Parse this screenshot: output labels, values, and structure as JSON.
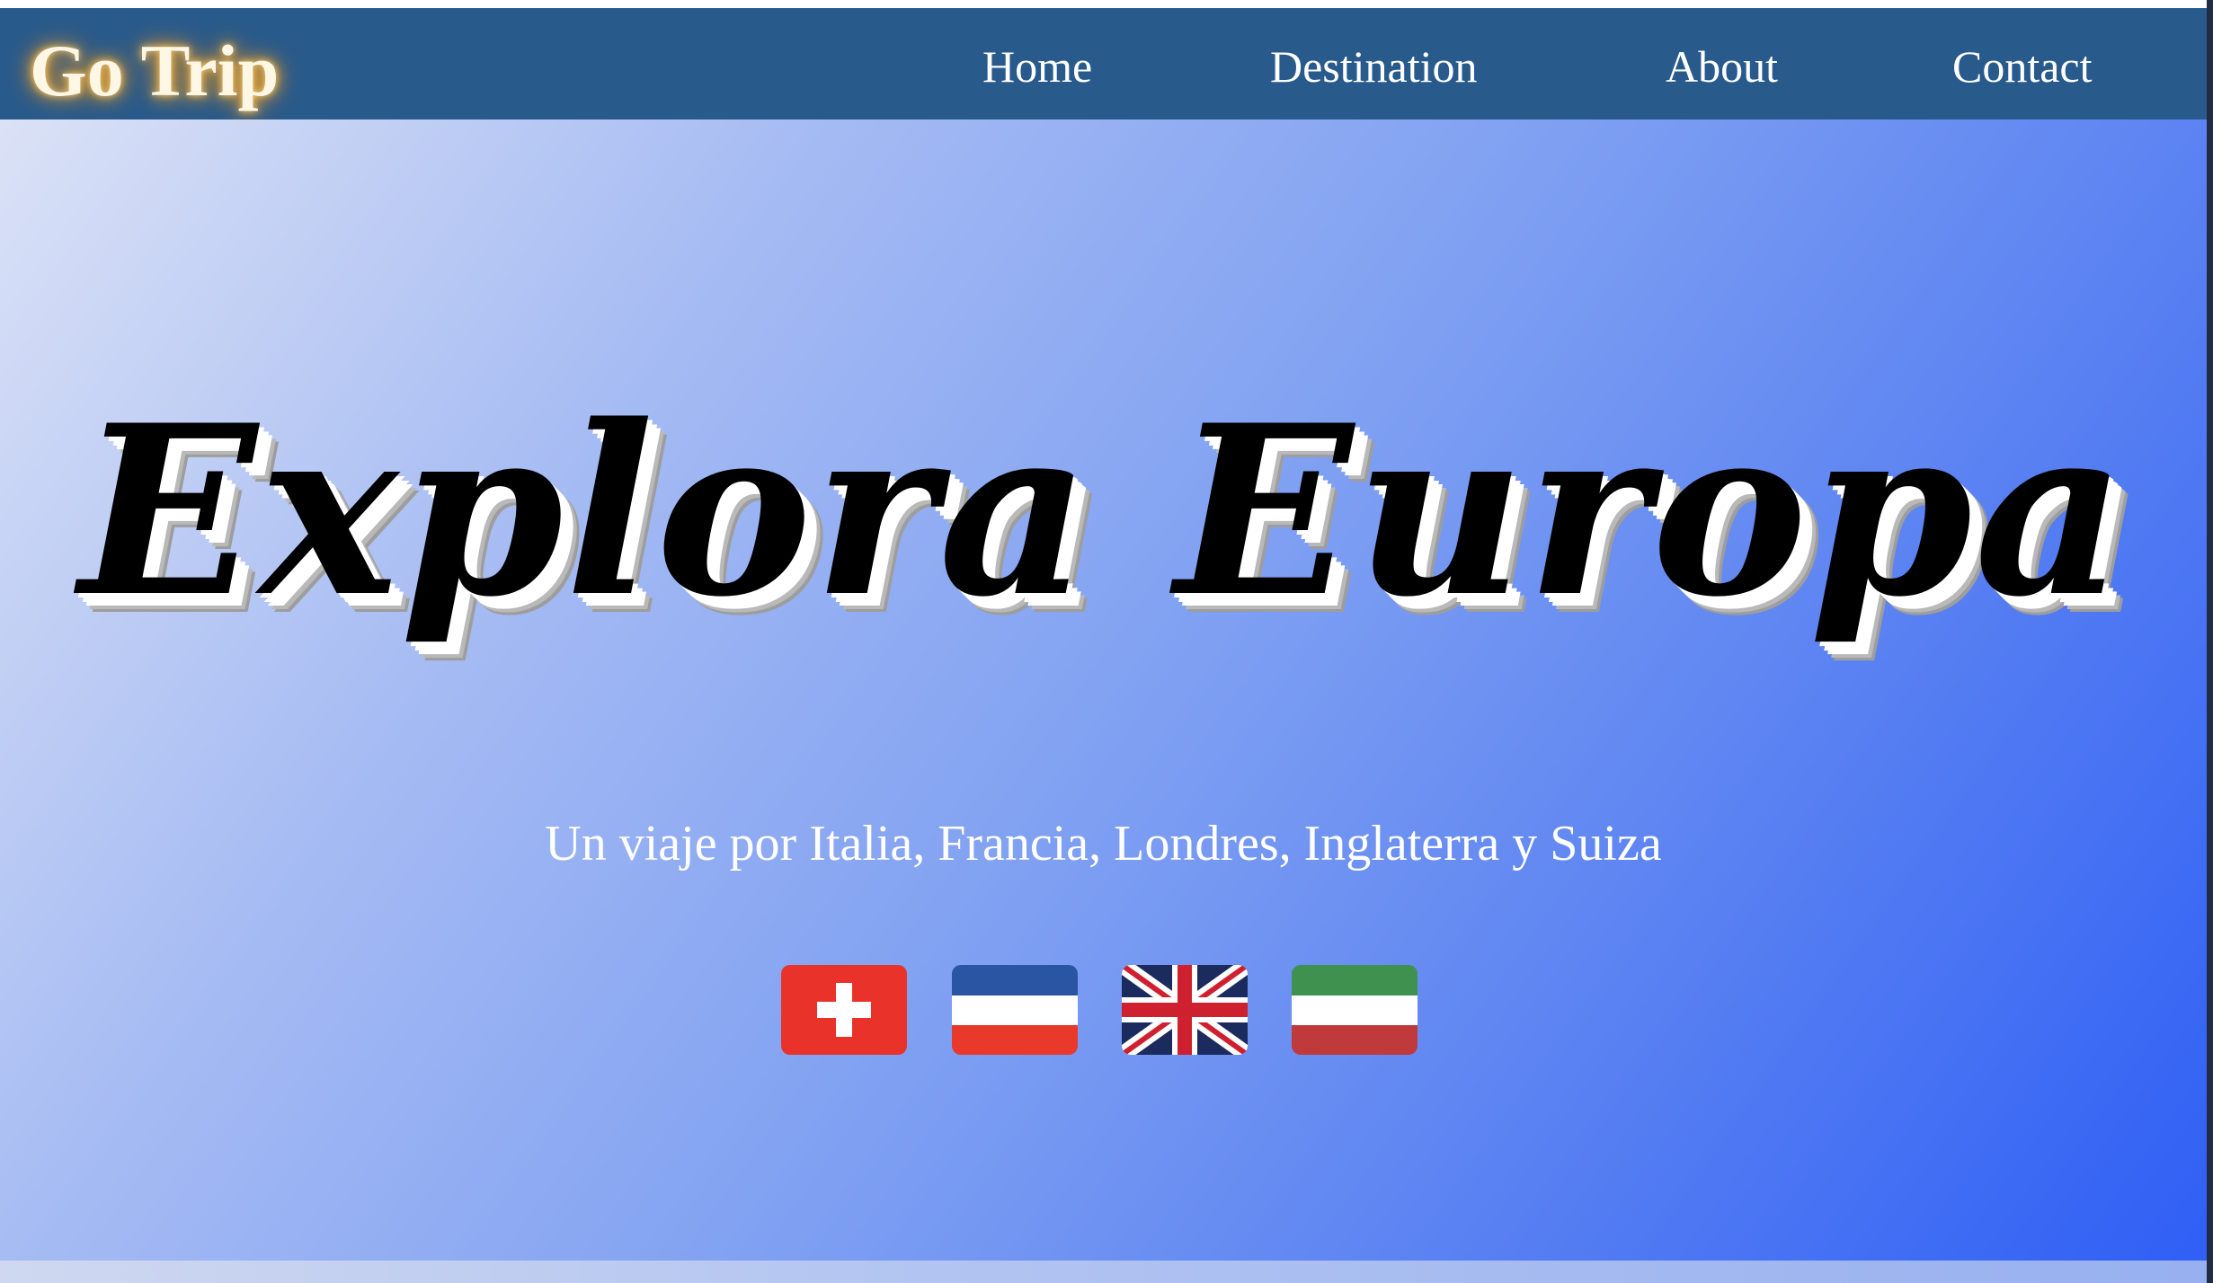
{
  "navbar": {
    "brand": "Go Trip",
    "links": [
      {
        "label": "Home"
      },
      {
        "label": "Destination"
      },
      {
        "label": "About"
      },
      {
        "label": "Contact"
      }
    ],
    "background": "#285a8c"
  },
  "hero": {
    "title": "Explora Europa",
    "subtitle": "Un viaje por Italia, Francia, Londres, Inglaterra y Suiza",
    "gradient": [
      "#dbe2f6",
      "#a4baf3",
      "#7fa0f2",
      "#5981f2",
      "#2f5ff5"
    ],
    "flags": [
      {
        "icon": "swiss-flag-icon",
        "colors": [
          "#e8322a",
          "#ffffff"
        ]
      },
      {
        "icon": "blue-white-red-flag-icon",
        "colors": [
          "#2a55a2",
          "#ffffff",
          "#e8392a"
        ]
      },
      {
        "icon": "union-jack-flag-icon",
        "colors": [
          "#1b2b5e",
          "#ffffff",
          "#cf2030"
        ]
      },
      {
        "icon": "green-white-red-flag-icon",
        "colors": [
          "#3f9150",
          "#ffffff",
          "#c0393b"
        ]
      }
    ]
  }
}
